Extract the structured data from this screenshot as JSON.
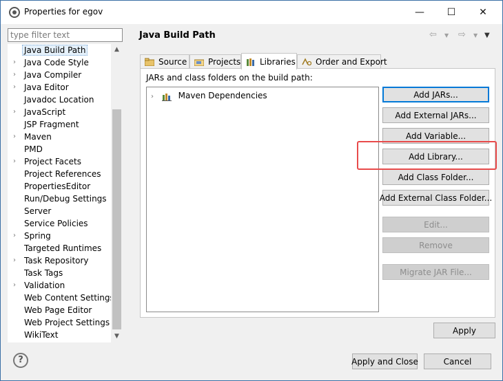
{
  "window": {
    "title": "Properties for egov",
    "minimize_glyph": "—",
    "maximize_glyph": "☐",
    "close_glyph": "✕"
  },
  "filter": {
    "placeholder": "type filter text",
    "value": ""
  },
  "tree": {
    "items": [
      {
        "label": "Java Build Path",
        "expandable": false,
        "selected": true
      },
      {
        "label": "Java Code Style",
        "expandable": true
      },
      {
        "label": "Java Compiler",
        "expandable": true
      },
      {
        "label": "Java Editor",
        "expandable": true
      },
      {
        "label": "Javadoc Location",
        "expandable": false
      },
      {
        "label": "JavaScript",
        "expandable": true
      },
      {
        "label": "JSP Fragment",
        "expandable": false
      },
      {
        "label": "Maven",
        "expandable": true
      },
      {
        "label": "PMD",
        "expandable": false
      },
      {
        "label": "Project Facets",
        "expandable": true
      },
      {
        "label": "Project References",
        "expandable": false
      },
      {
        "label": "PropertiesEditor",
        "expandable": false
      },
      {
        "label": "Run/Debug Settings",
        "expandable": false
      },
      {
        "label": "Server",
        "expandable": false
      },
      {
        "label": "Service Policies",
        "expandable": false
      },
      {
        "label": "Spring",
        "expandable": true
      },
      {
        "label": "Targeted Runtimes",
        "expandable": false
      },
      {
        "label": "Task Repository",
        "expandable": true
      },
      {
        "label": "Task Tags",
        "expandable": false
      },
      {
        "label": "Validation",
        "expandable": true
      },
      {
        "label": "Web Content Settings",
        "expandable": false
      },
      {
        "label": "Web Page Editor",
        "expandable": false
      },
      {
        "label": "Web Project Settings",
        "expandable": false
      },
      {
        "label": "WikiText",
        "expandable": false
      }
    ]
  },
  "page": {
    "title": "Java Build Path"
  },
  "tabs": [
    {
      "label": "Source",
      "icon": "source-folder-icon"
    },
    {
      "label": "Projects",
      "icon": "projects-icon"
    },
    {
      "label": "Libraries",
      "icon": "libraries-icon",
      "active": true
    },
    {
      "label": "Order and Export",
      "icon": "order-export-icon"
    }
  ],
  "libraries": {
    "caption": "JARs and class folders on the build path:",
    "entries": [
      {
        "label": "Maven Dependencies",
        "icon": "library-icon"
      }
    ]
  },
  "buttons": {
    "add_jars": "Add JARs...",
    "add_external_jars": "Add External JARs...",
    "add_variable": "Add Variable...",
    "add_library": "Add Library...",
    "add_class_folder": "Add Class Folder...",
    "add_external_class_folder": "Add External Class Folder...",
    "edit": "Edit...",
    "remove": "Remove",
    "migrate_jar": "Migrate JAR File...",
    "apply": "Apply",
    "apply_and_close": "Apply and Close",
    "cancel": "Cancel"
  },
  "colors": {
    "highlight": "#e84a4a",
    "accent": "#0078d7"
  }
}
